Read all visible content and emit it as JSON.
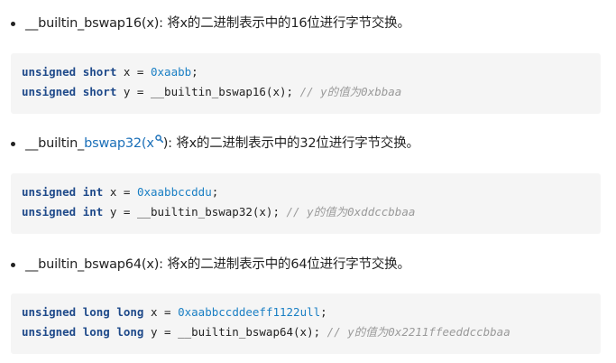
{
  "items": [
    {
      "bullet": {
        "text": "__builtin_bswap16(x): 将x的二进制表示中的16位进行字节交换。"
      },
      "code": [
        {
          "kw": "unsigned short",
          "mid": " x = ",
          "num": "0xaabb",
          "tail": ";",
          "comment": ""
        },
        {
          "kw": "unsigned short",
          "mid": " y = __builtin_bswap16(x); ",
          "num": "",
          "tail": "",
          "comment": "// y的值为0xbbaa"
        }
      ]
    },
    {
      "bullet": {
        "pre": "__builtin_",
        "link": "bswap32(x",
        "icon": "search-icon",
        "post": "): 将x的二进制表示中的32位进行字节交换。"
      },
      "code": [
        {
          "kw": "unsigned int",
          "mid": " x = ",
          "num": "0xaabbccddu",
          "tail": ";",
          "comment": ""
        },
        {
          "kw": "unsigned int",
          "mid": " y = __builtin_bswap32(x); ",
          "num": "",
          "tail": "",
          "comment": "// y的值为0xddccbbaa"
        }
      ]
    },
    {
      "bullet": {
        "text": "__builtin_bswap64(x): 将x的二进制表示中的64位进行字节交换。"
      },
      "code": [
        {
          "kw": "unsigned long long",
          "mid": " x = ",
          "num": "0xaabbccddeeff1122ull",
          "tail": ";",
          "comment": ""
        },
        {
          "kw": "unsigned long long",
          "mid": " y = __builtin_bswap64(x); ",
          "num": "",
          "tail": "",
          "comment": "// y的值为0x2211ffeeddccbbaa"
        }
      ]
    }
  ],
  "colors": {
    "keyword": "#1f4a8a",
    "number": "#1a7fc4",
    "comment": "#9a9a9a",
    "code_bg": "#f5f5f5",
    "link": "#1a6fb8"
  }
}
